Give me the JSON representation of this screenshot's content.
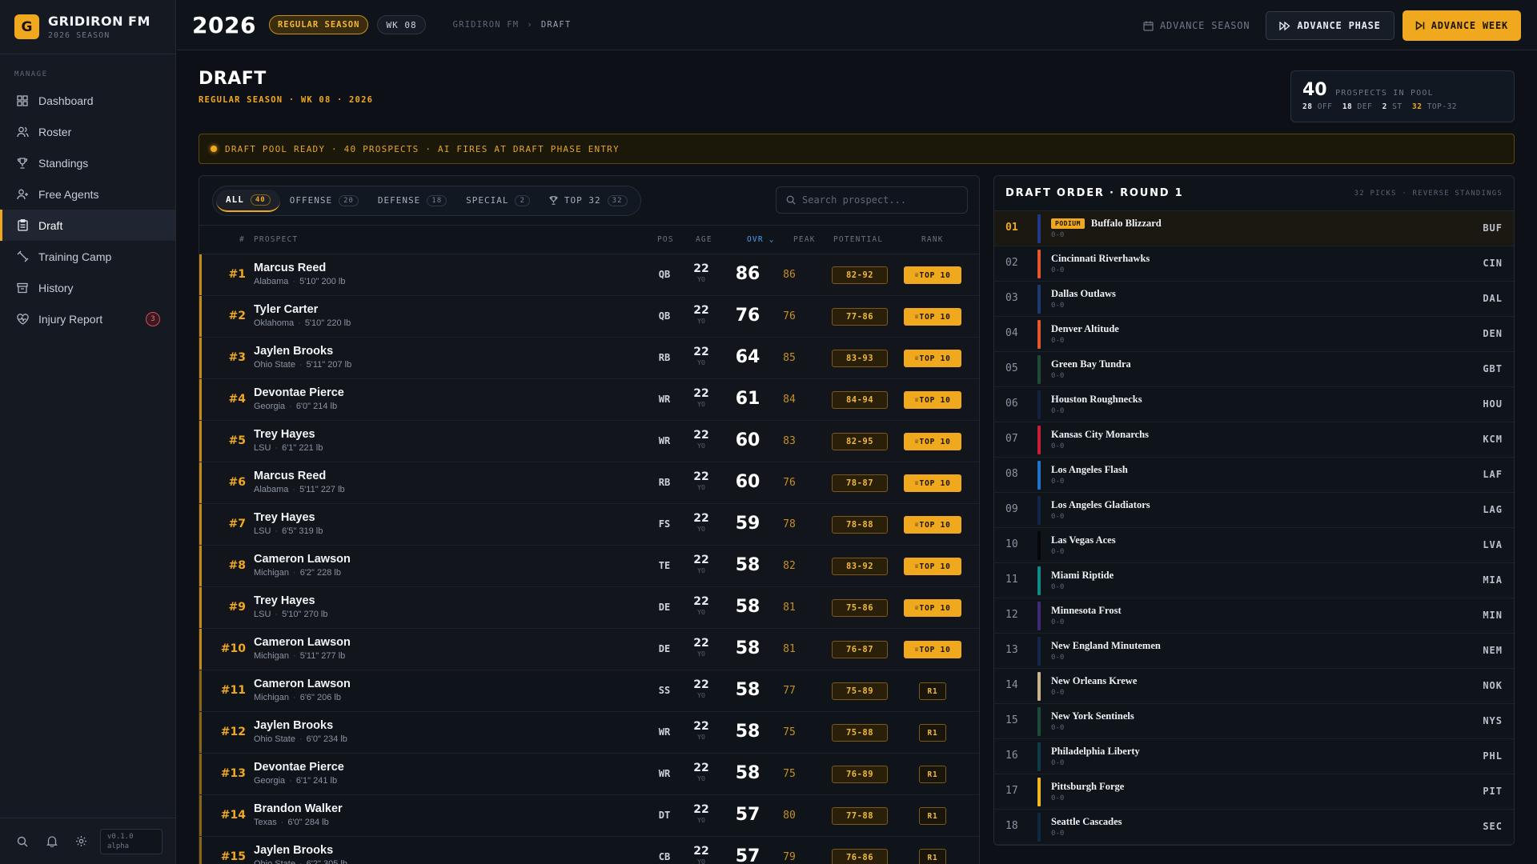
{
  "brand": {
    "logo_letter": "G",
    "name": "GRIDIRON FM",
    "subtitle": "2026 SEASON"
  },
  "sidebar": {
    "section_label": "MANAGE",
    "items": [
      {
        "label": "Dashboard",
        "icon": "grid-icon"
      },
      {
        "label": "Roster",
        "icon": "users-icon"
      },
      {
        "label": "Standings",
        "icon": "trophy-icon"
      },
      {
        "label": "Free Agents",
        "icon": "user-plus-icon"
      },
      {
        "label": "Draft",
        "icon": "clipboard-icon",
        "active": true
      },
      {
        "label": "Training Camp",
        "icon": "dumbbell-icon"
      },
      {
        "label": "History",
        "icon": "archive-icon"
      },
      {
        "label": "Injury Report",
        "icon": "heart-pulse-icon",
        "badge": "3"
      }
    ],
    "footer": {
      "version": "v0.1.0 alpha"
    }
  },
  "topbar": {
    "year": "2026",
    "phase": "REGULAR SEASON",
    "week": "WK 08",
    "breadcrumb": [
      "GRIDIRON FM",
      "DRAFT"
    ],
    "advance_season": "ADVANCE SEASON",
    "advance_phase": "ADVANCE PHASE",
    "advance_week": "ADVANCE WEEK"
  },
  "page": {
    "title": "DRAFT",
    "subtitle": "REGULAR SEASON · WK 08 · 2026"
  },
  "pool": {
    "count": "40",
    "label": "PROSPECTS IN POOL",
    "off": "28",
    "off_label": "OFF",
    "def": "18",
    "def_label": "DEF",
    "st": "2",
    "st_label": "ST",
    "top32": "32",
    "top32_label": "TOP-32"
  },
  "banner": {
    "text": "DRAFT POOL READY · 40 PROSPECTS · AI FIRES AT DRAFT PHASE ENTRY"
  },
  "filters": {
    "tabs": [
      {
        "label": "ALL",
        "count": "40",
        "active": true
      },
      {
        "label": "OFFENSE",
        "count": "20"
      },
      {
        "label": "DEFENSE",
        "count": "18"
      },
      {
        "label": "SPECIAL",
        "count": "2"
      },
      {
        "label": "TOP 32",
        "count": "32"
      }
    ],
    "search_placeholder": "Search prospect..."
  },
  "table": {
    "headers": {
      "num": "#",
      "prospect": "PROSPECT",
      "pos": "POS",
      "age": "AGE",
      "ovr": "OVR",
      "peak": "PEAK",
      "potential": "POTENTIAL",
      "rank": "RANK"
    },
    "age_unit": "YO",
    "rows": [
      {
        "rank": "#1",
        "name": "Marcus Reed",
        "school": "Alabama",
        "size": "5'10\" 200 lb",
        "pos": "QB",
        "age": "22",
        "ovr": "86",
        "peak": "86",
        "potential": "82-92",
        "tag": "TOP 10"
      },
      {
        "rank": "#2",
        "name": "Tyler Carter",
        "school": "Oklahoma",
        "size": "5'10\" 220 lb",
        "pos": "QB",
        "age": "22",
        "ovr": "76",
        "peak": "76",
        "potential": "77-86",
        "tag": "TOP 10"
      },
      {
        "rank": "#3",
        "name": "Jaylen Brooks",
        "school": "Ohio State",
        "size": "5'11\" 207 lb",
        "pos": "RB",
        "age": "22",
        "ovr": "64",
        "peak": "85",
        "potential": "83-93",
        "tag": "TOP 10"
      },
      {
        "rank": "#4",
        "name": "Devontae Pierce",
        "school": "Georgia",
        "size": "6'0\" 214 lb",
        "pos": "WR",
        "age": "22",
        "ovr": "61",
        "peak": "84",
        "potential": "84-94",
        "tag": "TOP 10"
      },
      {
        "rank": "#5",
        "name": "Trey Hayes",
        "school": "LSU",
        "size": "6'1\" 221 lb",
        "pos": "WR",
        "age": "22",
        "ovr": "60",
        "peak": "83",
        "potential": "82-95",
        "tag": "TOP 10"
      },
      {
        "rank": "#6",
        "name": "Marcus Reed",
        "school": "Alabama",
        "size": "5'11\" 227 lb",
        "pos": "RB",
        "age": "22",
        "ovr": "60",
        "peak": "76",
        "potential": "78-87",
        "tag": "TOP 10"
      },
      {
        "rank": "#7",
        "name": "Trey Hayes",
        "school": "LSU",
        "size": "6'5\" 319 lb",
        "pos": "FS",
        "age": "22",
        "ovr": "59",
        "peak": "78",
        "potential": "78-88",
        "tag": "TOP 10"
      },
      {
        "rank": "#8",
        "name": "Cameron Lawson",
        "school": "Michigan",
        "size": "6'2\" 228 lb",
        "pos": "TE",
        "age": "22",
        "ovr": "58",
        "peak": "82",
        "potential": "83-92",
        "tag": "TOP 10"
      },
      {
        "rank": "#9",
        "name": "Trey Hayes",
        "school": "LSU",
        "size": "5'10\" 270 lb",
        "pos": "DE",
        "age": "22",
        "ovr": "58",
        "peak": "81",
        "potential": "75-86",
        "tag": "TOP 10"
      },
      {
        "rank": "#10",
        "name": "Cameron Lawson",
        "school": "Michigan",
        "size": "5'11\" 277 lb",
        "pos": "DE",
        "age": "22",
        "ovr": "58",
        "peak": "81",
        "potential": "76-87",
        "tag": "TOP 10"
      },
      {
        "rank": "#11",
        "name": "Cameron Lawson",
        "school": "Michigan",
        "size": "6'6\" 206 lb",
        "pos": "SS",
        "age": "22",
        "ovr": "58",
        "peak": "77",
        "potential": "75-89",
        "tag": "R1"
      },
      {
        "rank": "#12",
        "name": "Jaylen Brooks",
        "school": "Ohio State",
        "size": "6'0\" 234 lb",
        "pos": "WR",
        "age": "22",
        "ovr": "58",
        "peak": "75",
        "potential": "75-88",
        "tag": "R1"
      },
      {
        "rank": "#13",
        "name": "Devontae Pierce",
        "school": "Georgia",
        "size": "6'1\" 241 lb",
        "pos": "WR",
        "age": "22",
        "ovr": "58",
        "peak": "75",
        "potential": "76-89",
        "tag": "R1"
      },
      {
        "rank": "#14",
        "name": "Brandon Walker",
        "school": "Texas",
        "size": "6'0\" 284 lb",
        "pos": "DT",
        "age": "22",
        "ovr": "57",
        "peak": "80",
        "potential": "77-88",
        "tag": "R1"
      },
      {
        "rank": "#15",
        "name": "Jaylen Brooks",
        "school": "Ohio State",
        "size": "6'2\" 305 lb",
        "pos": "CB",
        "age": "22",
        "ovr": "57",
        "peak": "79",
        "potential": "76-86",
        "tag": "R1"
      }
    ]
  },
  "draft_order": {
    "title": "DRAFT ORDER · ROUND 1",
    "meta": "32 PICKS · REVERSE STANDINGS",
    "podium_label": "PODIUM",
    "picks": [
      {
        "num": "01",
        "team": "Buffalo Blizzard",
        "record": "0-0",
        "abbr": "BUF",
        "color": "#1f3a8a",
        "podium": true
      },
      {
        "num": "02",
        "team": "Cincinnati Riverhawks",
        "record": "0-0",
        "abbr": "CIN",
        "color": "#e2572b"
      },
      {
        "num": "03",
        "team": "Dallas Outlaws",
        "record": "0-0",
        "abbr": "DAL",
        "color": "#1d3b6e"
      },
      {
        "num": "04",
        "team": "Denver Altitude",
        "record": "0-0",
        "abbr": "DEN",
        "color": "#e2572b"
      },
      {
        "num": "05",
        "team": "Green Bay Tundra",
        "record": "0-0",
        "abbr": "GBT",
        "color": "#1f4a35"
      },
      {
        "num": "06",
        "team": "Houston Roughnecks",
        "record": "0-0",
        "abbr": "HOU",
        "color": "#13233f"
      },
      {
        "num": "07",
        "team": "Kansas City Monarchs",
        "record": "0-0",
        "abbr": "KCM",
        "color": "#c81f36"
      },
      {
        "num": "08",
        "team": "Los Angeles Flash",
        "record": "0-0",
        "abbr": "LAF",
        "color": "#1d74c9"
      },
      {
        "num": "09",
        "team": "Los Angeles Gladiators",
        "record": "0-0",
        "abbr": "LAG",
        "color": "#14254a"
      },
      {
        "num": "10",
        "team": "Las Vegas Aces",
        "record": "0-0",
        "abbr": "LVA",
        "color": "#05070a"
      },
      {
        "num": "11",
        "team": "Miami Riptide",
        "record": "0-0",
        "abbr": "MIA",
        "color": "#0f8a86"
      },
      {
        "num": "12",
        "team": "Minnesota Frost",
        "record": "0-0",
        "abbr": "MIN",
        "color": "#3f2a78"
      },
      {
        "num": "13",
        "team": "New England Minutemen",
        "record": "0-0",
        "abbr": "NEM",
        "color": "#14264a"
      },
      {
        "num": "14",
        "team": "New Orleans Krewe",
        "record": "0-0",
        "abbr": "NOK",
        "color": "#c9b489"
      },
      {
        "num": "15",
        "team": "New York Sentinels",
        "record": "0-0",
        "abbr": "NYS",
        "color": "#1e4a3a"
      },
      {
        "num": "16",
        "team": "Philadelphia Liberty",
        "record": "0-0",
        "abbr": "PHL",
        "color": "#0f3b47"
      },
      {
        "num": "17",
        "team": "Pittsburgh Forge",
        "record": "0-0",
        "abbr": "PIT",
        "color": "#f0b81e"
      },
      {
        "num": "18",
        "team": "Seattle Cascades",
        "record": "0-0",
        "abbr": "SEC",
        "color": "#0f2a40"
      }
    ]
  }
}
